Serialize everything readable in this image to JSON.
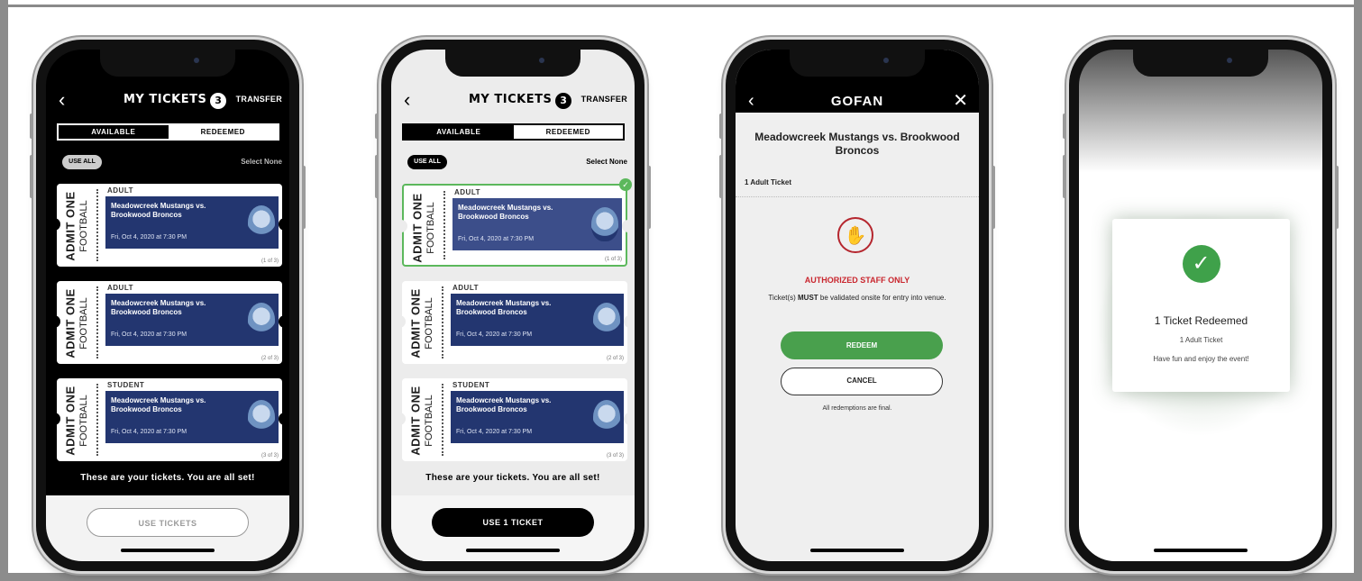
{
  "ticket_app": {
    "back_icon": "chevron-left-icon",
    "title": "MY TICKETS",
    "ticket_count": "3",
    "transfer": "TRANSFER",
    "tabs": {
      "available": "AVAILABLE",
      "redeemed": "REDEEMED"
    },
    "use_all": "USE ALL",
    "select_none": "Select None",
    "tickets": [
      {
        "admit": "ADMIT ONE",
        "sport": "FOOTBALL",
        "category": "ADULT",
        "game": "Meadowcreek Mustangs vs. Brookwood Broncos",
        "date": "Fri, Oct 4, 2020 at 7:30 PM",
        "number": "(1 of 3)"
      },
      {
        "admit": "ADMIT ONE",
        "sport": "FOOTBALL",
        "category": "ADULT",
        "game": "Meadowcreek Mustangs vs. Brookwood Broncos",
        "date": "Fri, Oct 4, 2020 at 7:30 PM",
        "number": "(2 of 3)"
      },
      {
        "admit": "ADMIT ONE",
        "sport": "FOOTBALL",
        "category": "STUDENT",
        "game": "Meadowcreek Mustangs vs. Brookwood Broncos",
        "date": "Fri, Oct 4, 2020 at 7:30 PM",
        "number": "(3 of 3)"
      }
    ],
    "all_set": "These are your tickets. You are all set!",
    "use_tickets": "USE TICKETS",
    "use_one_ticket": "USE 1 TICKET"
  },
  "redeem_screen": {
    "logo": "GOFAN",
    "close_icon": "close-icon",
    "event": "Meadowcreek Mustangs vs. Brookwood Broncos",
    "ticket_line": "1 Adult Ticket",
    "auth": "AUTHORIZED STAFF ONLY",
    "must_pre": "Ticket(s)",
    "must_bold": "MUST",
    "must_post": "be validated onsite for entry into venue.",
    "redeem": "REDEEM",
    "cancel": "CANCEL",
    "final": "All redemptions are final."
  },
  "success_screen": {
    "check_icon": "checkmark-icon",
    "title": "1 Ticket Redeemed",
    "sub": "1 Adult Ticket",
    "message": "Have fun and enjoy the event!"
  },
  "colors": {
    "navy": "#233670",
    "green": "#49a04d",
    "red": "#c9262e",
    "black": "#000000"
  }
}
